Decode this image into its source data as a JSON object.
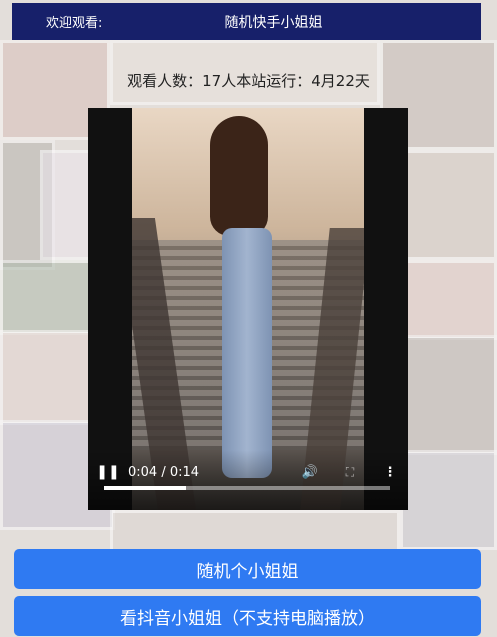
{
  "header": {
    "welcome": "欢迎观看:",
    "title": "随机快手小姐姐"
  },
  "stats": {
    "text": "观看人数：17人本站运行：4月22天"
  },
  "player": {
    "time_display": "0:04 / 0:14",
    "progress_fraction": 0.286,
    "play_icon": "pause-icon",
    "volume_icon": "volume-icon",
    "fullscreen_icon": "fullscreen-icon",
    "more_icon": "more-vertical-icon"
  },
  "buttons": {
    "random": "随机个小姐姐",
    "douyin": "看抖音小姐姐（不支持电脑播放）"
  },
  "colors": {
    "header_bg": "#17206a",
    "button_bg": "#2f7af2"
  }
}
